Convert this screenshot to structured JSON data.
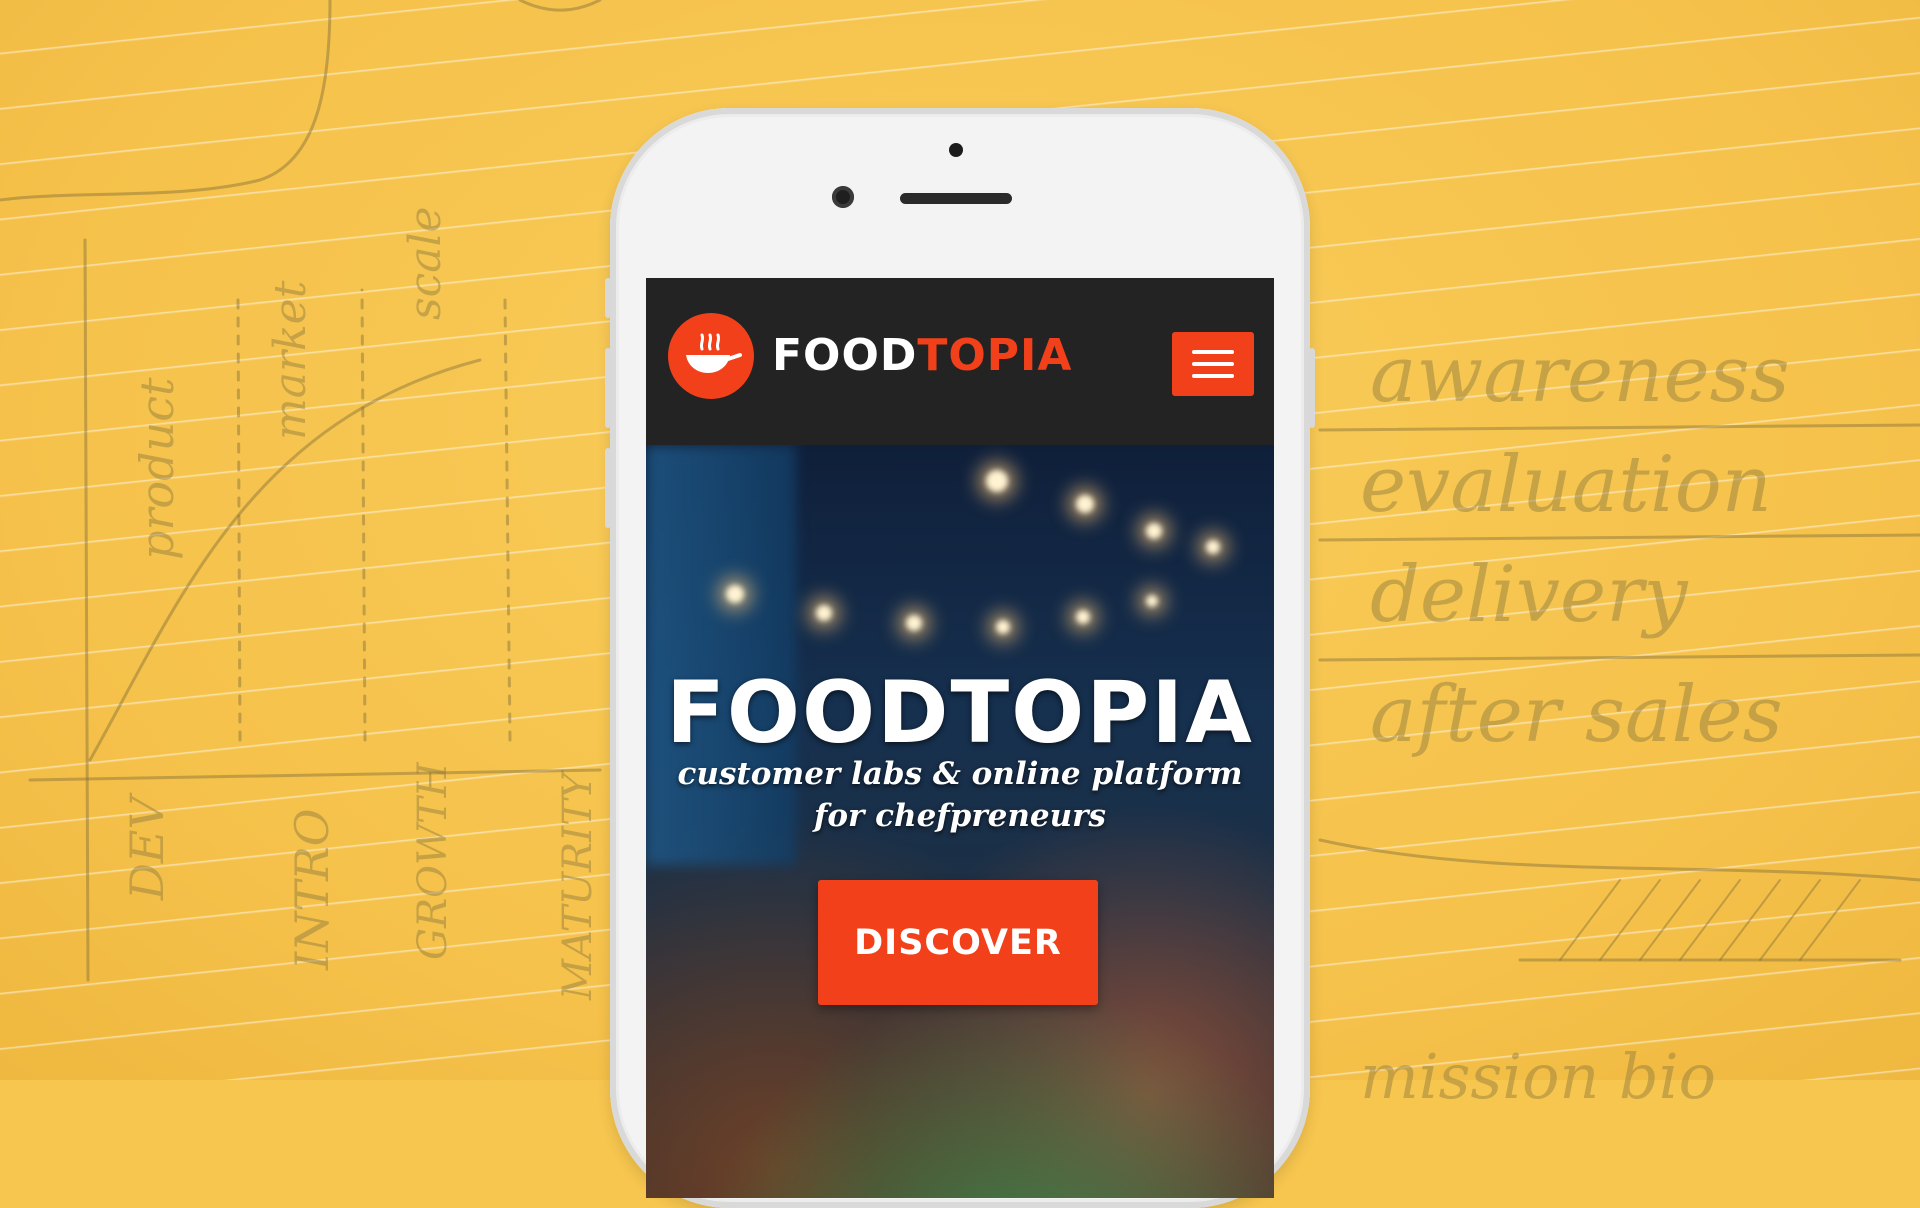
{
  "background": {
    "color": "#f7c64f",
    "sketch_words": [
      "awareness",
      "evaluation",
      "delivery",
      "after sales",
      "DEV",
      "INTRO",
      "GROWTH",
      "MATURITY",
      "product",
      "market",
      "scale",
      "mission bio"
    ]
  },
  "app": {
    "brand": {
      "logo_icon": "wok-pan-icon",
      "name_part1": "FOOD",
      "name_part2": "TOPIA",
      "accent_color": "#f2411a"
    },
    "nav": {
      "menu_icon": "hamburger-menu-icon"
    },
    "hero": {
      "title": "FOODTOPIA",
      "subtitle_line1": "customer labs & online platform",
      "subtitle_line2": "for chefpreneurs",
      "cta_label": "DISCOVER"
    }
  }
}
